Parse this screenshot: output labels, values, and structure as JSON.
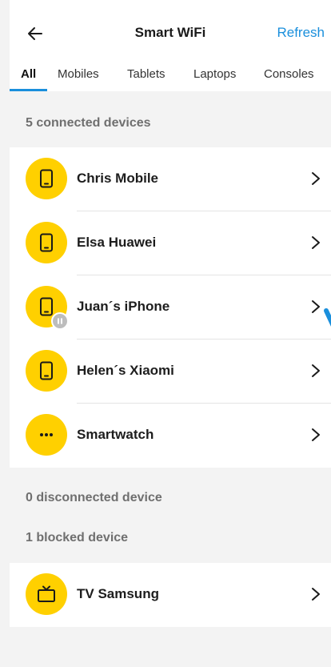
{
  "header": {
    "title": "Smart WiFi",
    "refresh_label": "Refresh"
  },
  "tabs": [
    {
      "label": "All",
      "active": true
    },
    {
      "label": "Mobiles",
      "active": false
    },
    {
      "label": "Tablets",
      "active": false
    },
    {
      "label": "Laptops",
      "active": false
    },
    {
      "label": "Consoles",
      "active": false
    }
  ],
  "sections": {
    "connected_label": "5 connected devices",
    "disconnected_label": "0 disconnected device",
    "blocked_label": "1 blocked device"
  },
  "connected_devices": [
    {
      "name": "Chris Mobile",
      "icon": "phone-icon",
      "paused": false
    },
    {
      "name": "Elsa Huawei",
      "icon": "phone-icon",
      "paused": false
    },
    {
      "name": "Juan´s iPhone",
      "icon": "phone-icon",
      "paused": true
    },
    {
      "name": "Helen´s Xiaomi",
      "icon": "phone-icon",
      "paused": false
    },
    {
      "name": "Smartwatch",
      "icon": "more-dots-icon",
      "paused": false
    }
  ],
  "blocked_devices": [
    {
      "name": "TV Samsung",
      "icon": "tv-icon",
      "paused": false
    }
  ],
  "colors": {
    "accent": "#1a8fdc",
    "avatar": "#ffd000",
    "background": "#f3f3f3",
    "section_text": "#6f6f6f"
  }
}
